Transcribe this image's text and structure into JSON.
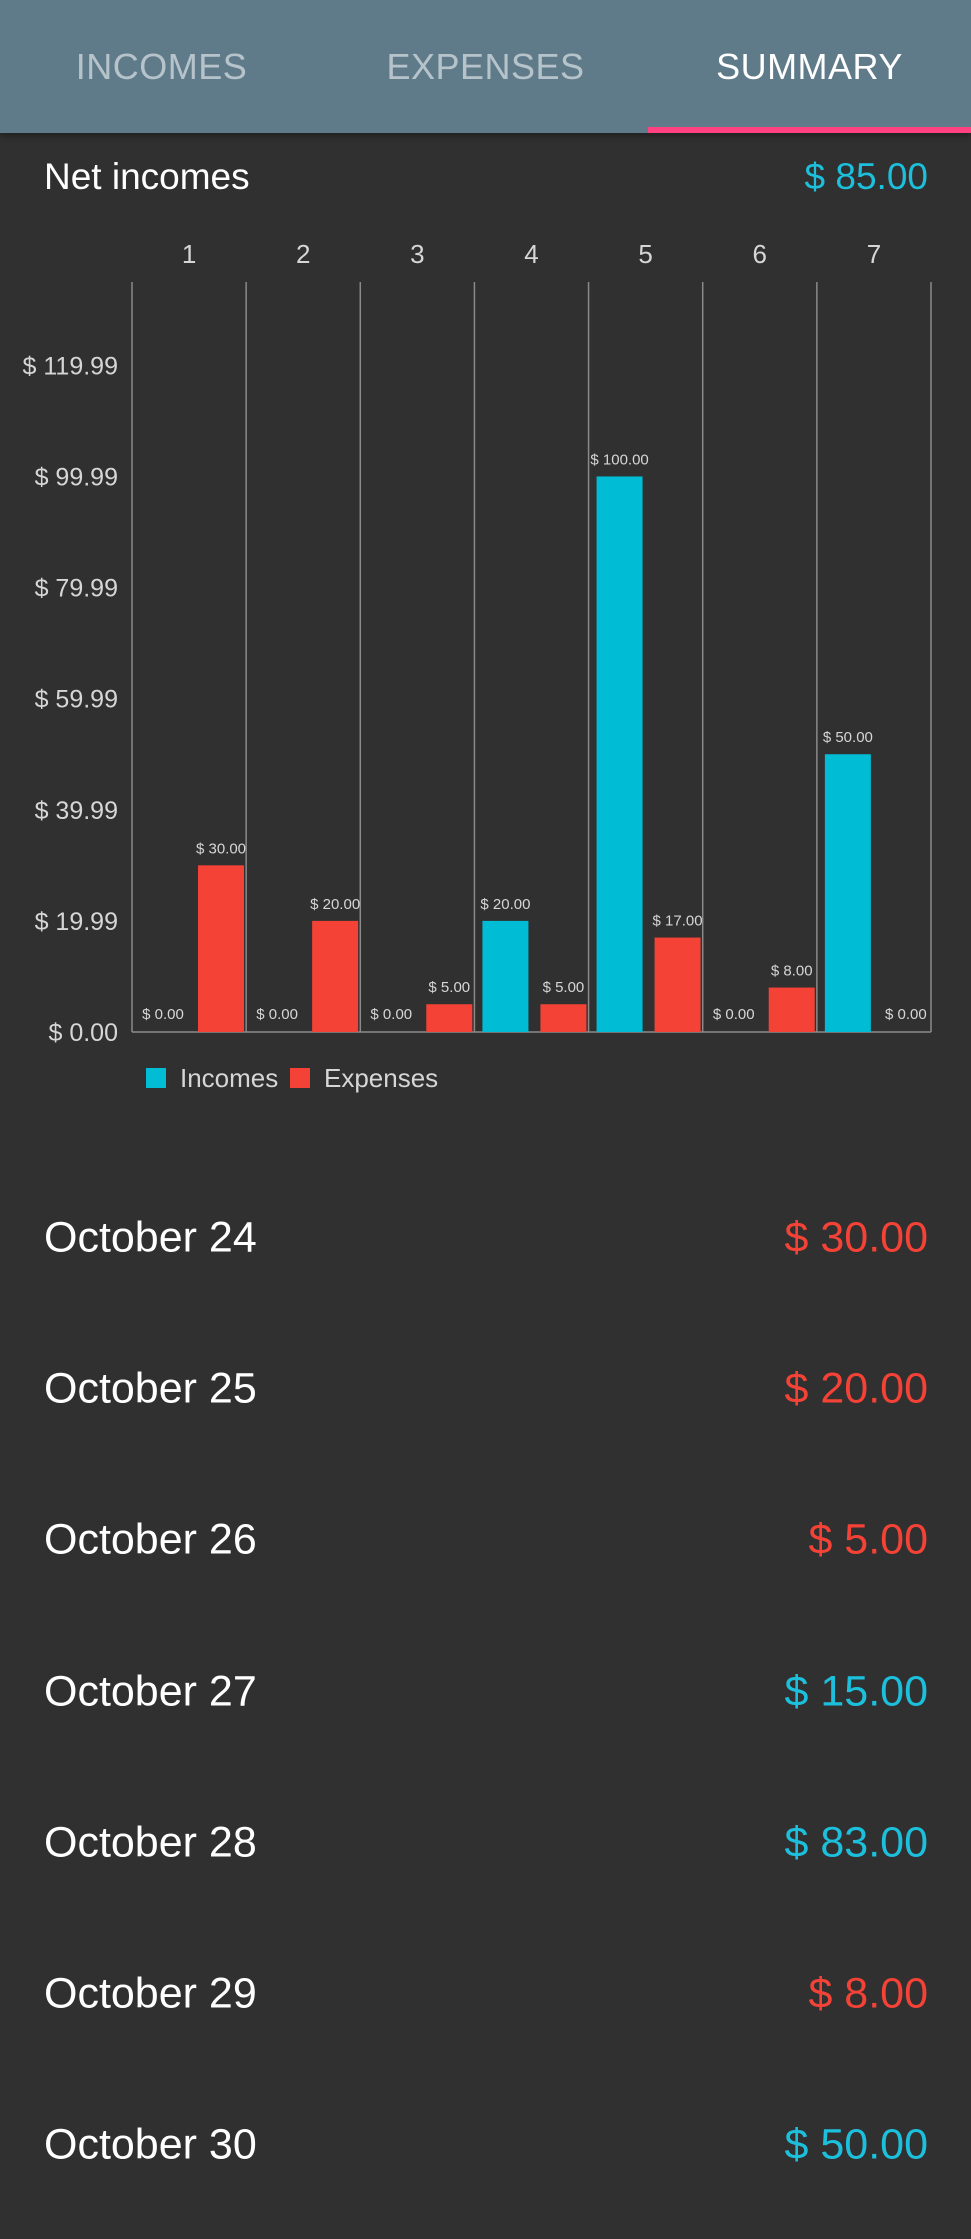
{
  "tabs": [
    {
      "label": "INCOMES",
      "active": false
    },
    {
      "label": "EXPENSES",
      "active": false
    },
    {
      "label": "SUMMARY",
      "active": true
    }
  ],
  "net": {
    "label": "Net incomes",
    "value": "$ 85.00"
  },
  "colors": {
    "incomes": "#00bcd4",
    "expenses": "#f44336",
    "positive_text": "#1cc0dc",
    "negative_text": "#f44336",
    "tab_bar": "#5f7b8a",
    "tab_indicator": "#ff4081",
    "background": "#303030"
  },
  "chart_data": {
    "type": "bar",
    "categories": [
      "1",
      "2",
      "3",
      "4",
      "5",
      "6",
      "7"
    ],
    "series": [
      {
        "name": "Incomes",
        "color": "#00bcd4",
        "values": [
          0,
          0,
          0,
          20,
          100,
          0,
          50
        ],
        "labels": [
          "$ 0.00",
          "$ 0.00",
          "$ 0.00",
          "$ 20.00",
          "$ 100.00",
          "$ 0.00",
          "$ 50.00"
        ]
      },
      {
        "name": "Expenses",
        "color": "#f44336",
        "values": [
          30,
          20,
          5,
          5,
          17,
          8,
          0
        ],
        "labels": [
          "$ 30.00",
          "$ 20.00",
          "$ 5.00",
          "$ 5.00",
          "$ 17.00",
          "$ 8.00",
          "$ 0.00"
        ]
      }
    ],
    "y_ticks": [
      0,
      19.99,
      39.99,
      59.99,
      79.99,
      99.99,
      119.99
    ],
    "y_tick_labels": [
      "$ 0.00",
      "$ 19.99",
      "$ 39.99",
      "$ 59.99",
      "$ 79.99",
      "$ 99.99",
      "$ 119.99"
    ],
    "ylim": [
      0,
      135
    ],
    "x_axis_position": "top",
    "grid": "vertical",
    "legend_placement": "bottom-left"
  },
  "rows": [
    {
      "date": "October 24",
      "amount": "$ 30.00",
      "sign": "negative"
    },
    {
      "date": "October 25",
      "amount": "$ 20.00",
      "sign": "negative"
    },
    {
      "date": "October 26",
      "amount": "$ 5.00",
      "sign": "negative"
    },
    {
      "date": "October 27",
      "amount": "$ 15.00",
      "sign": "positive"
    },
    {
      "date": "October 28",
      "amount": "$ 83.00",
      "sign": "positive"
    },
    {
      "date": "October 29",
      "amount": "$ 8.00",
      "sign": "negative"
    },
    {
      "date": "October 30",
      "amount": "$ 50.00",
      "sign": "positive"
    }
  ]
}
